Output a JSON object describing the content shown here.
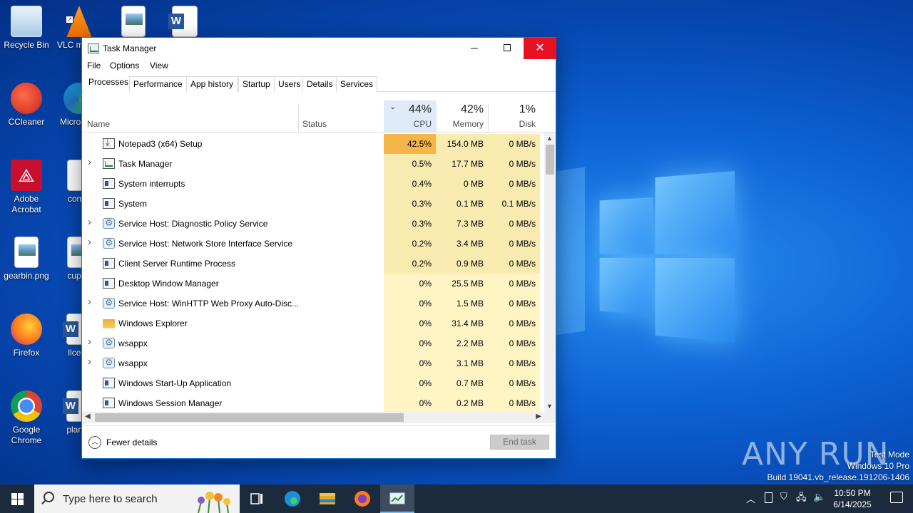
{
  "desktop": {
    "icons": [
      {
        "label": "Recycle Bin",
        "icon": "recycle-bin-icon"
      },
      {
        "label": "VLC m play",
        "icon": "vlc-icon"
      },
      {
        "label": "",
        "icon": "image-file-icon"
      },
      {
        "label": "",
        "icon": "word-doc-icon"
      },
      {
        "label": "CCleaner",
        "icon": "ccleaner-icon"
      },
      {
        "label": "Micro Edg",
        "icon": "edge-icon"
      },
      {
        "label": "Adobe Acrobat",
        "icon": "acrobat-icon"
      },
      {
        "label": "comin",
        "icon": "file-icon"
      },
      {
        "label": "gearbin.png",
        "icon": "image-file-icon"
      },
      {
        "label": "cupthr",
        "icon": "file-icon"
      },
      {
        "label": "Firefox",
        "icon": "firefox-icon"
      },
      {
        "label": "llceffo",
        "icon": "word-doc-icon"
      },
      {
        "label": "Google Chrome",
        "icon": "chrome-icon"
      },
      {
        "label": "planus",
        "icon": "word-doc-icon"
      }
    ]
  },
  "window": {
    "title": "Task Manager",
    "controls": {
      "minimize": "─",
      "close": "✕"
    }
  },
  "menu": [
    "File",
    "Options",
    "View"
  ],
  "tabs": [
    "Processes",
    "Performance",
    "App history",
    "Startup",
    "Users",
    "Details",
    "Services"
  ],
  "columns": {
    "name": "Name",
    "status": "Status",
    "cpu": {
      "pct": "44%",
      "label": "CPU"
    },
    "memory": {
      "pct": "42%",
      "label": "Memory"
    },
    "disk": {
      "pct": "1%",
      "label": "Disk"
    }
  },
  "processes": [
    {
      "name": "Notepad3 (x64) Setup",
      "expandable": false,
      "icon": "setup-icon",
      "cpu": "42.5%",
      "memory": "154.0 MB",
      "disk": "0 MB/s"
    },
    {
      "name": "Task Manager",
      "expandable": true,
      "icon": "task-manager-icon",
      "cpu": "0.5%",
      "memory": "17.7 MB",
      "disk": "0 MB/s"
    },
    {
      "name": "System interrupts",
      "expandable": false,
      "icon": "window-icon",
      "cpu": "0.4%",
      "memory": "0 MB",
      "disk": "0 MB/s"
    },
    {
      "name": "System",
      "expandable": false,
      "icon": "window-icon",
      "cpu": "0.3%",
      "memory": "0.1 MB",
      "disk": "0.1 MB/s"
    },
    {
      "name": "Service Host: Diagnostic Policy Service",
      "expandable": true,
      "icon": "gear-icon",
      "cpu": "0.3%",
      "memory": "7.3 MB",
      "disk": "0 MB/s"
    },
    {
      "name": "Service Host: Network Store Interface Service",
      "expandable": true,
      "icon": "gear-icon",
      "cpu": "0.2%",
      "memory": "3.4 MB",
      "disk": "0 MB/s"
    },
    {
      "name": "Client Server Runtime Process",
      "expandable": false,
      "icon": "window-icon",
      "cpu": "0.2%",
      "memory": "0.9 MB",
      "disk": "0 MB/s"
    },
    {
      "name": "Desktop Window Manager",
      "expandable": false,
      "icon": "window-icon",
      "cpu": "0%",
      "memory": "25.5 MB",
      "disk": "0 MB/s"
    },
    {
      "name": "Service Host: WinHTTP Web Proxy Auto-Disc...",
      "expandable": true,
      "icon": "gear-icon",
      "cpu": "0%",
      "memory": "1.5 MB",
      "disk": "0 MB/s"
    },
    {
      "name": "Windows Explorer",
      "expandable": false,
      "icon": "folder-icon",
      "cpu": "0%",
      "memory": "31.4 MB",
      "disk": "0 MB/s"
    },
    {
      "name": "wsappx",
      "expandable": true,
      "icon": "gear-icon",
      "cpu": "0%",
      "memory": "2.2 MB",
      "disk": "0 MB/s"
    },
    {
      "name": "wsappx",
      "expandable": true,
      "icon": "gear-icon",
      "cpu": "0%",
      "memory": "3.1 MB",
      "disk": "0 MB/s"
    },
    {
      "name": "Windows Start-Up Application",
      "expandable": false,
      "icon": "window-icon",
      "cpu": "0%",
      "memory": "0.7 MB",
      "disk": "0 MB/s"
    },
    {
      "name": "Windows Session Manager",
      "expandable": false,
      "icon": "window-icon",
      "cpu": "0%",
      "memory": "0.2 MB",
      "disk": "0 MB/s"
    }
  ],
  "footer": {
    "fewer_details": "Fewer details",
    "end_task": "End task"
  },
  "colors": {
    "cpu_high": "#f5b54a",
    "cpu_mid": "#f9eab0",
    "cpu_low": "#fff4c4",
    "accent": "#0078d7",
    "close_red": "#e81123"
  },
  "watermark": {
    "brand": "ANY RUN",
    "line1": "Test Mode",
    "line2": "Windows 10 Pro",
    "line3": "Build 19041.vb_release.191206-1406"
  },
  "taskbar": {
    "search_placeholder": "Type here to search",
    "time": "10:50 PM",
    "date": "6/14/2025"
  }
}
